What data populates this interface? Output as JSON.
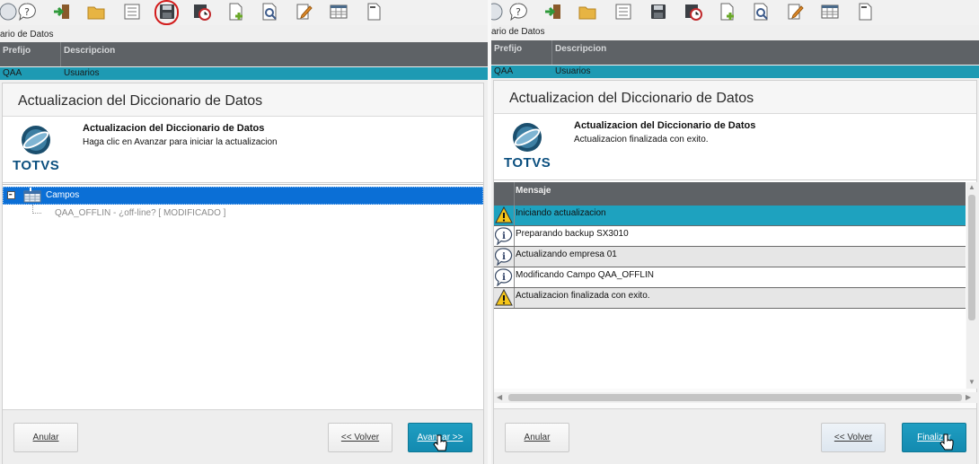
{
  "left": {
    "toolbar": {
      "highlighted": "save-icon"
    },
    "strip": {
      "title": "ario de Datos",
      "columns": [
        "Prefijo",
        "Descripcion"
      ],
      "row": {
        "prefijo": "QAA",
        "descripcion": "Usuarios"
      }
    },
    "dialog": {
      "title": "Actualizacion del Diccionario de Datos",
      "head_bold": "Actualizacion del Diccionario de Datos",
      "head_sub": "Haga clic en Avanzar para iniciar la actualizacion",
      "logo_text": "TOTVS",
      "tree": {
        "root_label": "Campos",
        "child_label": "QAA_OFFLIN - ¿off-line?  [ MODIFICADO ]"
      },
      "buttons": {
        "cancel": "Anular",
        "back": "<< Volver",
        "next": "Avanzar >>"
      }
    }
  },
  "right": {
    "strip": {
      "title": "ario de Datos",
      "columns": [
        "Prefijo",
        "Descripcion"
      ],
      "row": {
        "prefijo": "QAA",
        "descripcion": "Usuarios"
      }
    },
    "dialog": {
      "title": "Actualizacion del Diccionario de Datos",
      "head_bold": "Actualizacion del Diccionario de Datos",
      "head_sub": "Actualizacion finalizada con exito.",
      "logo_text": "TOTVS",
      "grid_header": "Mensaje",
      "messages": [
        {
          "icon": "warning-icon",
          "text": "Iniciando actualizacion"
        },
        {
          "icon": "info-icon",
          "text": "Preparando backup SX3010"
        },
        {
          "icon": "info-icon",
          "text": "Actualizando empresa 01"
        },
        {
          "icon": "info-icon",
          "text": "Modificando Campo QAA_OFFLIN"
        },
        {
          "icon": "warning-icon",
          "text": "Actualizacion finalizada con exito."
        }
      ],
      "buttons": {
        "cancel": "Anular",
        "back": "<< Volver",
        "finish": "Finalizar"
      }
    }
  },
  "colors": {
    "accent": "#1e9ab3",
    "header_dark": "#5e6266",
    "tree_selected": "#0b6fd6",
    "highlight_ring": "#d21c1c"
  }
}
